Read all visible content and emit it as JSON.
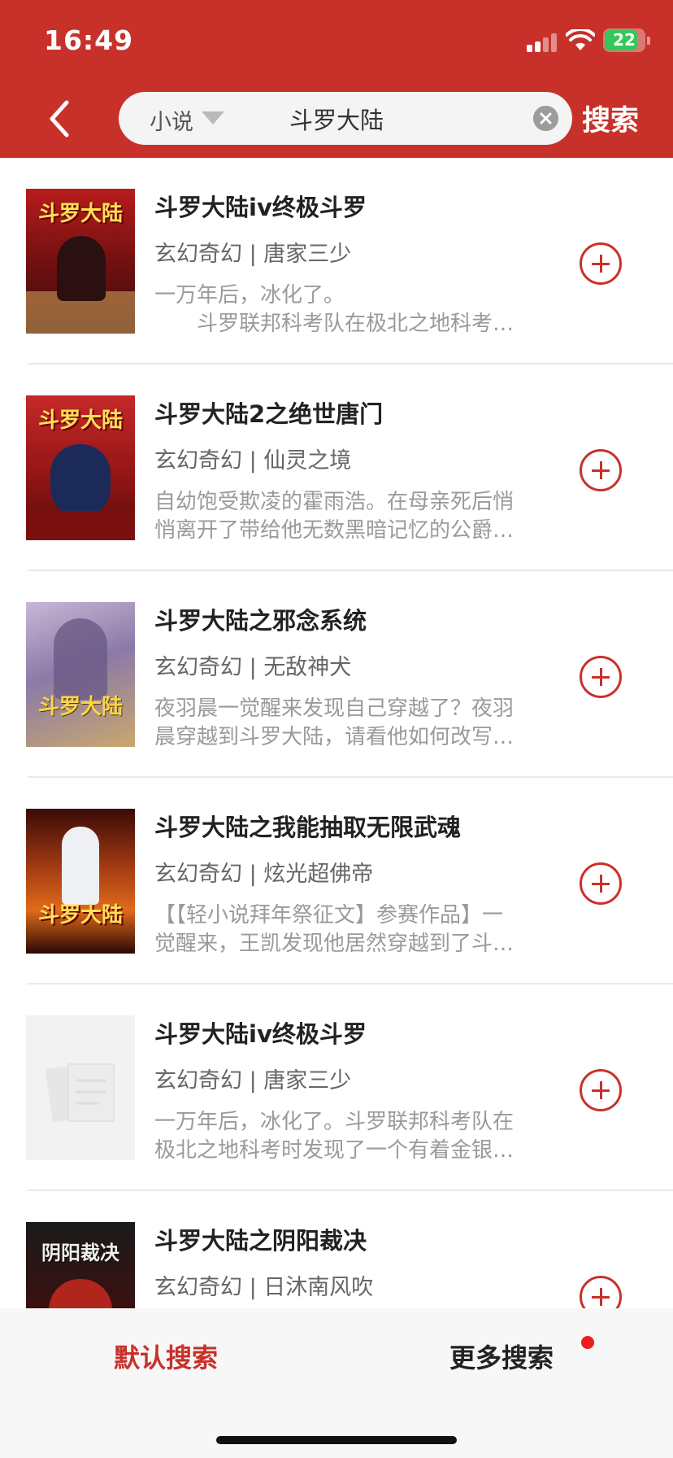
{
  "status_bar": {
    "time": "16:49",
    "battery": "22"
  },
  "search": {
    "category": "小说",
    "query": "斗罗大陆",
    "button_label": "搜索"
  },
  "results": [
    {
      "title": "斗罗大陆iv终极斗罗",
      "meta": "玄幻奇幻 | 唐家三少",
      "desc_line1": "一万年后，冰化了。",
      "desc_line2": "　　斗罗联邦科考队在极北之地科考…",
      "cover_text": "斗罗大陆"
    },
    {
      "title": "斗罗大陆2之绝世唐门",
      "meta": "玄幻奇幻 | 仙灵之境",
      "desc_line1": "自幼饱受欺凌的霍雨浩。在母亲死后悄",
      "desc_line2": "悄离开了带给他无数黑暗记忆的公爵…",
      "cover_text": "斗罗大陆"
    },
    {
      "title": "斗罗大陆之邪念系统",
      "meta": "玄幻奇幻 | 无敌神犬",
      "desc_line1": "夜羽晨一觉醒来发现自己穿越了？夜羽",
      "desc_line2": "晨穿越到斗罗大陆，请看他如何改写…",
      "cover_text": "斗罗大陆"
    },
    {
      "title": "斗罗大陆之我能抽取无限武魂",
      "meta": "玄幻奇幻 | 炫光超佛帝",
      "desc_line1": "【【轻小说拜年祭征文】参赛作品】一",
      "desc_line2": "觉醒来，王凯发现他居然穿越到了斗…",
      "cover_text": "斗罗大陆"
    },
    {
      "title": "斗罗大陆iv终极斗罗",
      "meta": "玄幻奇幻 | 唐家三少",
      "desc_line1": "一万年后，冰化了。斗罗联邦科考队在",
      "desc_line2": "极北之地科考时发现了一个有着金银…",
      "cover_text": ""
    },
    {
      "title": "斗罗大陆之阴阳裁决",
      "meta": "玄幻奇幻 | 日沐南风吹",
      "desc_line1": "",
      "desc_line2": "",
      "cover_text": "阴阳裁决"
    }
  ],
  "bottom_tabs": {
    "default_label": "默认搜索",
    "more_label": "更多搜索"
  },
  "colors": {
    "accent": "#c8312a",
    "badge": "#ee1d1d"
  }
}
